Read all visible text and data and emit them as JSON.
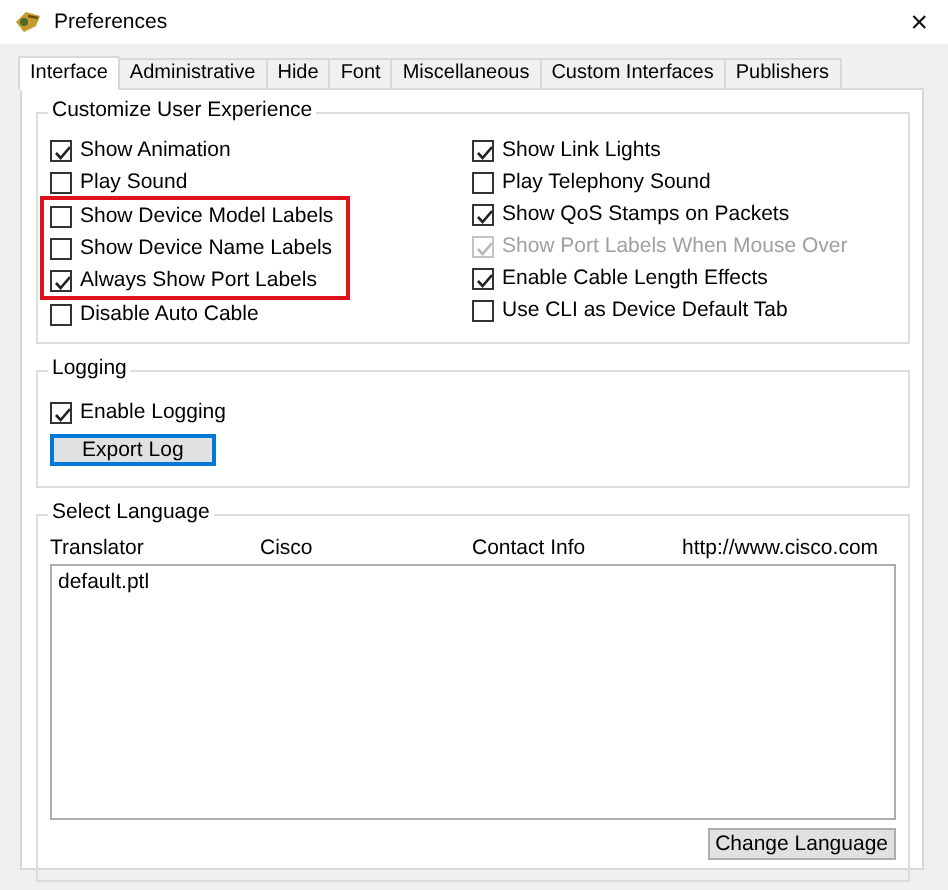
{
  "window": {
    "title": "Preferences",
    "close": "×"
  },
  "tabs": [
    {
      "label": "Interface",
      "selected": true
    },
    {
      "label": "Administrative",
      "selected": false
    },
    {
      "label": "Hide",
      "selected": false
    },
    {
      "label": "Font",
      "selected": false
    },
    {
      "label": "Miscellaneous",
      "selected": false
    },
    {
      "label": "Custom Interfaces",
      "selected": false
    },
    {
      "label": "Publishers",
      "selected": false
    }
  ],
  "customize_user_experience": {
    "title": "Customize User Experience",
    "left": [
      {
        "label": "Show Animation",
        "checked": true,
        "disabled": false,
        "highlighted": false
      },
      {
        "label": "Play Sound",
        "checked": false,
        "disabled": false,
        "highlighted": false
      },
      {
        "label": "Show Device Model Labels",
        "checked": false,
        "disabled": false,
        "highlighted": true
      },
      {
        "label": "Show Device Name Labels",
        "checked": false,
        "disabled": false,
        "highlighted": true
      },
      {
        "label": "Always Show Port Labels",
        "checked": true,
        "disabled": false,
        "highlighted": true
      },
      {
        "label": "Disable Auto Cable",
        "checked": false,
        "disabled": false,
        "highlighted": false
      }
    ],
    "right": [
      {
        "label": "Show Link Lights",
        "checked": true,
        "disabled": false
      },
      {
        "label": "Play Telephony Sound",
        "checked": false,
        "disabled": false
      },
      {
        "label": "Show QoS Stamps on Packets",
        "checked": true,
        "disabled": false
      },
      {
        "label": "Show Port Labels When Mouse Over",
        "checked": true,
        "disabled": true
      },
      {
        "label": "Enable Cable Length Effects",
        "checked": true,
        "disabled": false
      },
      {
        "label": "Use CLI as Device Default Tab",
        "checked": false,
        "disabled": false
      }
    ]
  },
  "logging": {
    "title": "Logging",
    "enable_logging": {
      "label": "Enable Logging",
      "checked": true,
      "disabled": false
    },
    "button": {
      "label": "Export Log",
      "focused": true
    }
  },
  "select_language": {
    "title": "Select Language",
    "columns": [
      "Translator",
      "Cisco",
      "Contact Info",
      "http://www.cisco.com"
    ],
    "items": [
      {
        "label": "default.ptl",
        "selected": false
      }
    ],
    "button": "Change Language"
  }
}
